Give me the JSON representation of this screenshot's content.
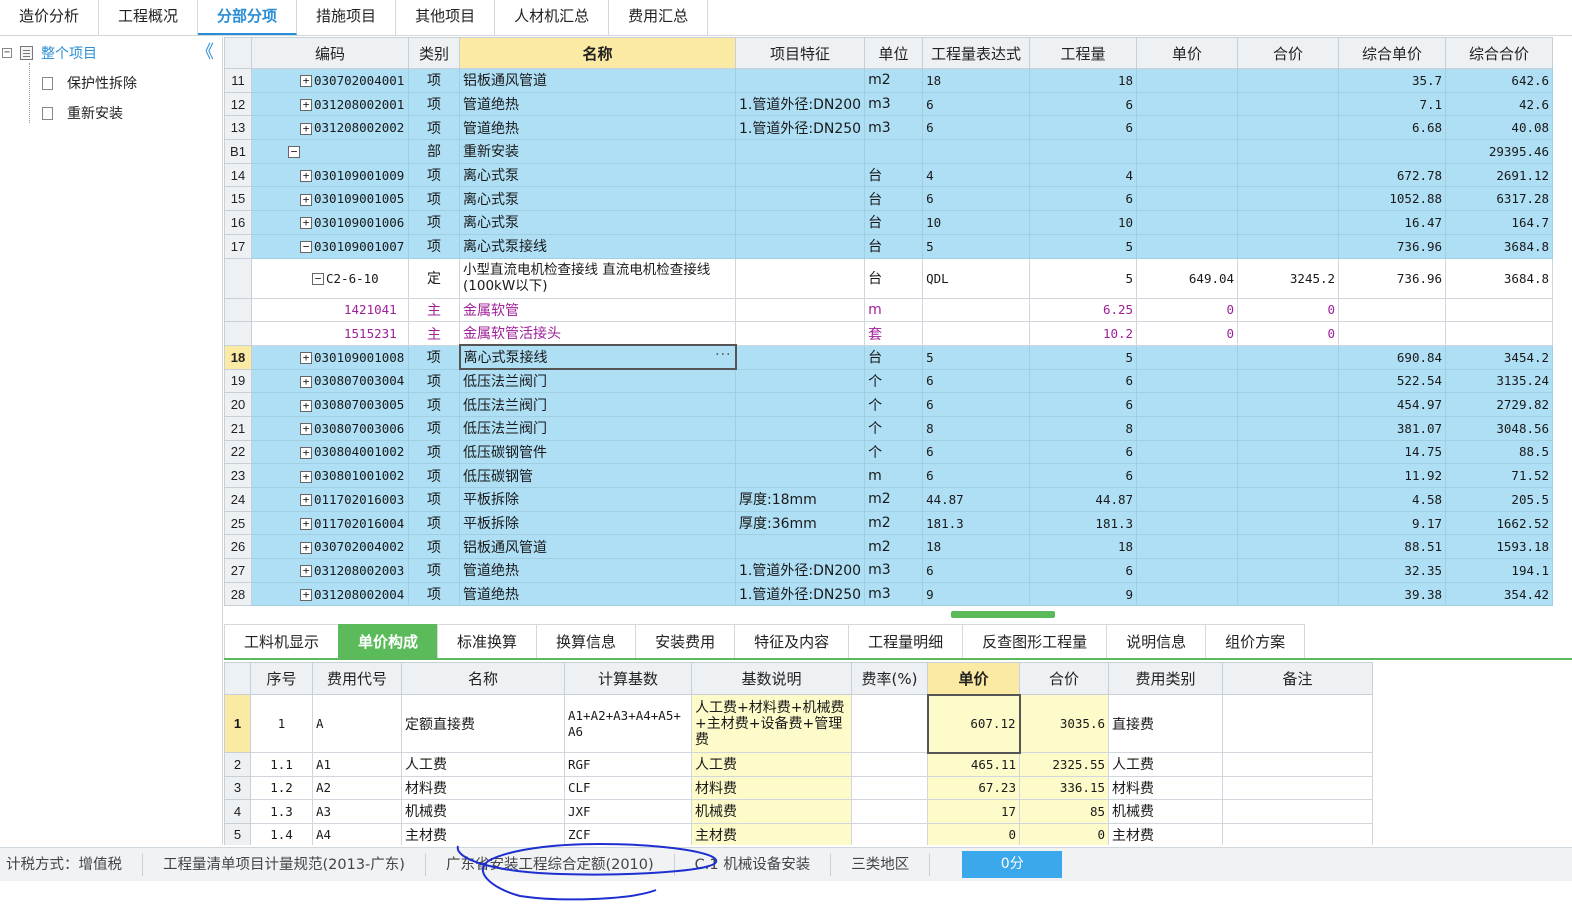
{
  "top_tabs": [
    "造价分析",
    "工程概况",
    "分部分项",
    "措施项目",
    "其他项目",
    "人材机汇总",
    "费用汇总"
  ],
  "top_tabs_active": 2,
  "tree": {
    "root": "整个项目",
    "root_toggle": "−",
    "collapse_symbol": "《",
    "children": [
      "保护性拆除",
      "重新安装"
    ]
  },
  "grid": {
    "columns": [
      "编码",
      "类别",
      "名称",
      "项目特征",
      "单位",
      "工程量表达式",
      "工程量",
      "单价",
      "合价",
      "综合单价",
      "综合合价"
    ],
    "rows": [
      {
        "no": "11",
        "kind": "xiang",
        "exp": "+",
        "code": "030702004001",
        "type": "项",
        "name": "铝板通风管道",
        "feature": "",
        "unit": "m2",
        "expr": "18",
        "qty": "18",
        "price": "",
        "total": "",
        "uprice": "35.7",
        "utotal": "642.6"
      },
      {
        "no": "12",
        "kind": "xiang",
        "exp": "+",
        "code": "031208002001",
        "type": "项",
        "name": "管道绝热",
        "feature": "1.管道外径:DN200",
        "unit": "m3",
        "expr": "6",
        "qty": "6",
        "price": "",
        "total": "",
        "uprice": "7.1",
        "utotal": "42.6"
      },
      {
        "no": "13",
        "kind": "xiang",
        "exp": "+",
        "code": "031208002002",
        "type": "项",
        "name": "管道绝热",
        "feature": "1.管道外径:DN250",
        "unit": "m3",
        "expr": "6",
        "qty": "6",
        "price": "",
        "total": "",
        "uprice": "6.68",
        "utotal": "40.08"
      },
      {
        "no": "B1",
        "kind": "bu",
        "exp": "−",
        "code": "",
        "type": "部",
        "name": "重新安装",
        "feature": "",
        "unit": "",
        "expr": "",
        "qty": "",
        "price": "",
        "total": "",
        "uprice": "",
        "utotal": "29395.46"
      },
      {
        "no": "14",
        "kind": "xiang",
        "exp": "+",
        "code": "030109001009",
        "type": "项",
        "name": "离心式泵",
        "feature": "",
        "unit": "台",
        "expr": "4",
        "qty": "4",
        "price": "",
        "total": "",
        "uprice": "672.78",
        "utotal": "2691.12"
      },
      {
        "no": "15",
        "kind": "xiang",
        "exp": "+",
        "code": "030109001005",
        "type": "项",
        "name": "离心式泵",
        "feature": "",
        "unit": "台",
        "expr": "6",
        "qty": "6",
        "price": "",
        "total": "",
        "uprice": "1052.88",
        "utotal": "6317.28"
      },
      {
        "no": "16",
        "kind": "xiang",
        "exp": "+",
        "code": "030109001006",
        "type": "项",
        "name": "离心式泵",
        "feature": "",
        "unit": "台",
        "expr": "10",
        "qty": "10",
        "price": "",
        "total": "",
        "uprice": "16.47",
        "utotal": "164.7"
      },
      {
        "no": "17",
        "kind": "xiang",
        "exp": "−",
        "code": "030109001007",
        "type": "项",
        "name": "离心式泵接线",
        "feature": "",
        "unit": "台",
        "expr": "5",
        "qty": "5",
        "price": "",
        "total": "",
        "uprice": "736.96",
        "utotal": "3684.8"
      },
      {
        "no": "",
        "kind": "ding",
        "exp": "−",
        "code": "C2-6-10",
        "type": "定",
        "name": "小型直流电机检查接线 直流电机检查接线(100kW以下)",
        "feature": "",
        "unit": "台",
        "expr": "QDL",
        "qty": "5",
        "price": "649.04",
        "total": "3245.2",
        "uprice": "736.96",
        "utotal": "3684.8"
      },
      {
        "no": "",
        "kind": "zhu",
        "exp": "",
        "code": "1421041",
        "type": "主",
        "name": "金属软管",
        "feature": "",
        "unit": "m",
        "expr": "",
        "qty": "6.25",
        "price": "0",
        "total": "0",
        "uprice": "",
        "utotal": ""
      },
      {
        "no": "",
        "kind": "zhu",
        "exp": "",
        "code": "1515231",
        "type": "主",
        "name": "金属软管活接头",
        "feature": "",
        "unit": "套",
        "expr": "",
        "qty": "10.2",
        "price": "0",
        "total": "0",
        "uprice": "",
        "utotal": ""
      },
      {
        "no": "18",
        "kind": "xiang",
        "exp": "+",
        "code": "030109001008",
        "type": "项",
        "name": "离心式泵接线",
        "feature": "",
        "unit": "台",
        "expr": "5",
        "qty": "5",
        "price": "",
        "total": "",
        "uprice": "690.84",
        "utotal": "3454.2",
        "current": true
      },
      {
        "no": "19",
        "kind": "xiang",
        "exp": "+",
        "code": "030807003004",
        "type": "项",
        "name": "低压法兰阀门",
        "feature": "",
        "unit": "个",
        "expr": "6",
        "qty": "6",
        "price": "",
        "total": "",
        "uprice": "522.54",
        "utotal": "3135.24"
      },
      {
        "no": "20",
        "kind": "xiang",
        "exp": "+",
        "code": "030807003005",
        "type": "项",
        "name": "低压法兰阀门",
        "feature": "",
        "unit": "个",
        "expr": "6",
        "qty": "6",
        "price": "",
        "total": "",
        "uprice": "454.97",
        "utotal": "2729.82"
      },
      {
        "no": "21",
        "kind": "xiang",
        "exp": "+",
        "code": "030807003006",
        "type": "项",
        "name": "低压法兰阀门",
        "feature": "",
        "unit": "个",
        "expr": "8",
        "qty": "8",
        "price": "",
        "total": "",
        "uprice": "381.07",
        "utotal": "3048.56"
      },
      {
        "no": "22",
        "kind": "xiang",
        "exp": "+",
        "code": "030804001002",
        "type": "项",
        "name": "低压碳钢管件",
        "feature": "",
        "unit": "个",
        "expr": "6",
        "qty": "6",
        "price": "",
        "total": "",
        "uprice": "14.75",
        "utotal": "88.5"
      },
      {
        "no": "23",
        "kind": "xiang",
        "exp": "+",
        "code": "030801001002",
        "type": "项",
        "name": "低压碳钢管",
        "feature": "",
        "unit": "m",
        "expr": "6",
        "qty": "6",
        "price": "",
        "total": "",
        "uprice": "11.92",
        "utotal": "71.52"
      },
      {
        "no": "24",
        "kind": "xiang",
        "exp": "+",
        "code": "011702016003",
        "type": "项",
        "name": "平板拆除",
        "feature": "厚度:18mm",
        "unit": "m2",
        "expr": "44.87",
        "qty": "44.87",
        "price": "",
        "total": "",
        "uprice": "4.58",
        "utotal": "205.5"
      },
      {
        "no": "25",
        "kind": "xiang",
        "exp": "+",
        "code": "011702016004",
        "type": "项",
        "name": "平板拆除",
        "feature": "厚度:36mm",
        "unit": "m2",
        "expr": "181.3",
        "qty": "181.3",
        "price": "",
        "total": "",
        "uprice": "9.17",
        "utotal": "1662.52"
      },
      {
        "no": "26",
        "kind": "xiang",
        "exp": "+",
        "code": "030702004002",
        "type": "项",
        "name": "铝板通风管道",
        "feature": "",
        "unit": "m2",
        "expr": "18",
        "qty": "18",
        "price": "",
        "total": "",
        "uprice": "88.51",
        "utotal": "1593.18"
      },
      {
        "no": "27",
        "kind": "xiang",
        "exp": "+",
        "code": "031208002003",
        "type": "项",
        "name": "管道绝热",
        "feature": "1.管道外径:DN200",
        "unit": "m3",
        "expr": "6",
        "qty": "6",
        "price": "",
        "total": "",
        "uprice": "32.35",
        "utotal": "194.1"
      },
      {
        "no": "28",
        "kind": "xiang",
        "exp": "+",
        "code": "031208002004",
        "type": "项",
        "name": "管道绝热",
        "feature": "1.管道外径:DN250",
        "unit": "m3",
        "expr": "9",
        "qty": "9",
        "price": "",
        "total": "",
        "uprice": "39.38",
        "utotal": "354.42"
      }
    ]
  },
  "bottom_tabs": [
    "工料机显示",
    "单价构成",
    "标准换算",
    "换算信息",
    "安装费用",
    "特征及内容",
    "工程量明细",
    "反查图形工程量",
    "说明信息",
    "组价方案"
  ],
  "bottom_tabs_active": 1,
  "sub_grid": {
    "columns": [
      "序号",
      "费用代号",
      "名称",
      "计算基数",
      "基数说明",
      "费率(%)",
      "单价",
      "合价",
      "费用类别",
      "备注"
    ],
    "rows": [
      {
        "no": "1",
        "seq": "1",
        "code": "A",
        "name": "定额直接费",
        "base": "A1+A2+A3+A4+A5+A6",
        "desc": "人工费+材料费+机械费+主材费+设备费+管理费",
        "rate": "",
        "price": "607.12",
        "total": "3035.6",
        "cat": "直接费",
        "note": "",
        "current": true
      },
      {
        "no": "2",
        "seq": "1.1",
        "code": "A1",
        "name": "人工费",
        "base": "RGF",
        "desc": "人工费",
        "rate": "",
        "price": "465.11",
        "total": "2325.55",
        "cat": "人工费",
        "note": ""
      },
      {
        "no": "3",
        "seq": "1.2",
        "code": "A2",
        "name": "材料费",
        "base": "CLF",
        "desc": "材料费",
        "rate": "",
        "price": "67.23",
        "total": "336.15",
        "cat": "材料费",
        "note": ""
      },
      {
        "no": "4",
        "seq": "1.3",
        "code": "A3",
        "name": "机械费",
        "base": "JXF",
        "desc": "机械费",
        "rate": "",
        "price": "17",
        "total": "85",
        "cat": "机械费",
        "note": ""
      },
      {
        "no": "5",
        "seq": "1.4",
        "code": "A4",
        "name": "主材费",
        "base": "ZCF",
        "desc": "主材费",
        "rate": "",
        "price": "0",
        "total": "0",
        "cat": "主材费",
        "note": ""
      }
    ]
  },
  "status_bar": {
    "items": [
      "计税方式：增值税",
      "工程量清单项目计量规范(2013-广东)",
      "广东省安装工程综合定额(2010)",
      "C.1 机械设备安装",
      "三类地区"
    ],
    "score": "0分"
  },
  "colors": {
    "accent_blue": "#2a8ed6",
    "row_blue": "#aedff5",
    "tab_green": "#5bbb5b",
    "header_yellow": "#fbeaa3",
    "main_material_purple": "#a0209a",
    "annotation_ink": "#1d2fd0"
  }
}
